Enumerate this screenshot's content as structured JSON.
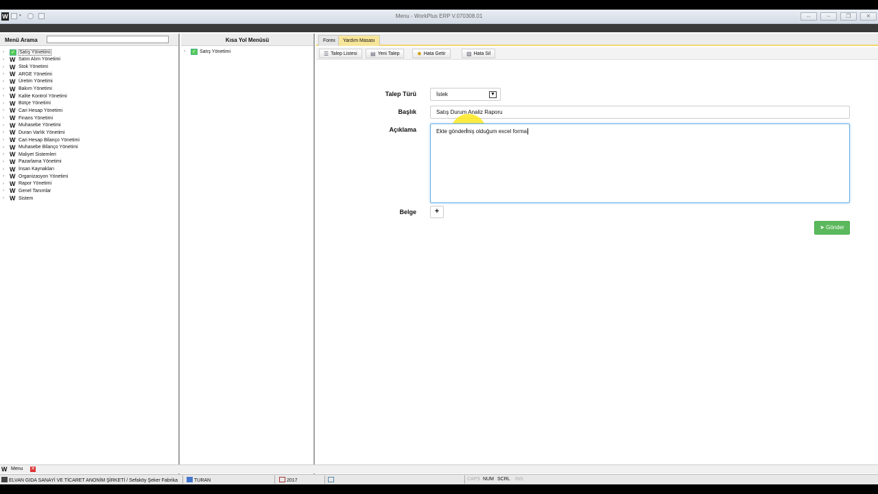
{
  "window": {
    "title": "Menu - WorkPlus ERP V.070308.01",
    "logo": "W",
    "controls": [
      "⇔",
      "–",
      "❐",
      "✕"
    ]
  },
  "left_panel": {
    "search_label": "Menü Arama",
    "search_value": "",
    "items": [
      {
        "label": "Satış Yönetimi",
        "icon": "check-icon",
        "selected": true
      },
      {
        "label": "Satın Alım Yönetimi",
        "icon": "w-logo-icon"
      },
      {
        "label": "Stok Yönetimi",
        "icon": "w-logo-icon"
      },
      {
        "label": "ARGE Yönetimi",
        "icon": "w-logo-icon"
      },
      {
        "label": "Üretim Yönetimi",
        "icon": "w-logo-icon"
      },
      {
        "label": "Bakım Yönetimi",
        "icon": "w-logo-icon"
      },
      {
        "label": "Kalite Kontrol Yönetimi",
        "icon": "w-logo-icon"
      },
      {
        "label": "Bütçe Yönetimi",
        "icon": "w-logo-icon"
      },
      {
        "label": "Cari Hesap Yönetimi",
        "icon": "w-logo-icon"
      },
      {
        "label": "Finans Yönetimi",
        "icon": "w-logo-icon"
      },
      {
        "label": "Muhasebe Yönetimi",
        "icon": "w-logo-icon"
      },
      {
        "label": "Duran Varlık Yönetimi",
        "icon": "w-logo-icon"
      },
      {
        "label": "Cari Hesap Bilanço Yönetimi",
        "icon": "w-logo-icon"
      },
      {
        "label": "Muhasebe Bilanço Yönetimi",
        "icon": "w-logo-icon"
      },
      {
        "label": "Maliyet Sistemleri",
        "icon": "w-logo-icon"
      },
      {
        "label": "Pazarlama Yönetimi",
        "icon": "w-logo-icon"
      },
      {
        "label": "İnsan Kaynakları",
        "icon": "w-logo-icon"
      },
      {
        "label": "Organizasyon Yönetimi",
        "icon": "w-logo-icon"
      },
      {
        "label": "Rapor Yönetimi",
        "icon": "w-logo-icon"
      },
      {
        "label": "Genel Tanımlar",
        "icon": "w-logo-icon"
      },
      {
        "label": "Sistem",
        "icon": "w-logo-icon"
      }
    ]
  },
  "shortcut_panel": {
    "title": "Kısa Yol Menüsü",
    "items": [
      {
        "label": "Satış Yönetimi",
        "icon": "check-icon"
      }
    ]
  },
  "tabs": [
    {
      "label": "Forex",
      "active": false
    },
    {
      "label": "Yardım Masası",
      "active": true
    }
  ],
  "toolbar": [
    {
      "label": "Talep Listesi",
      "icon": "list-icon"
    },
    {
      "label": "Yeni Talep",
      "icon": "new-document-icon"
    },
    {
      "label": "Hata Getir",
      "icon": "bug-icon"
    },
    {
      "label": "Hata Sil",
      "icon": "delete-document-icon"
    }
  ],
  "form": {
    "request_type_label": "Talep Türü",
    "request_type_value": "İstek",
    "title_label": "Başlık",
    "title_value": "Satış Durum Analiz Raporu",
    "description_label": "Açıklama",
    "description_value": "Ekte göndermiş olduğum excel forma",
    "document_label": "Belge",
    "add_button": "+",
    "send_button": "Gönder"
  },
  "taskbar": {
    "logo": "W",
    "label": "Menu"
  },
  "statusbar": {
    "company": "ELVAN GIDA SANAYİ VE TİCARET ANONİM ŞİRKETİ / Sefaköy Şeker Fabrika",
    "user": "TURAN",
    "year": "2017",
    "caps": "CAPS",
    "num": "NUM",
    "scrl": "SCRL",
    "ins": "INS"
  }
}
